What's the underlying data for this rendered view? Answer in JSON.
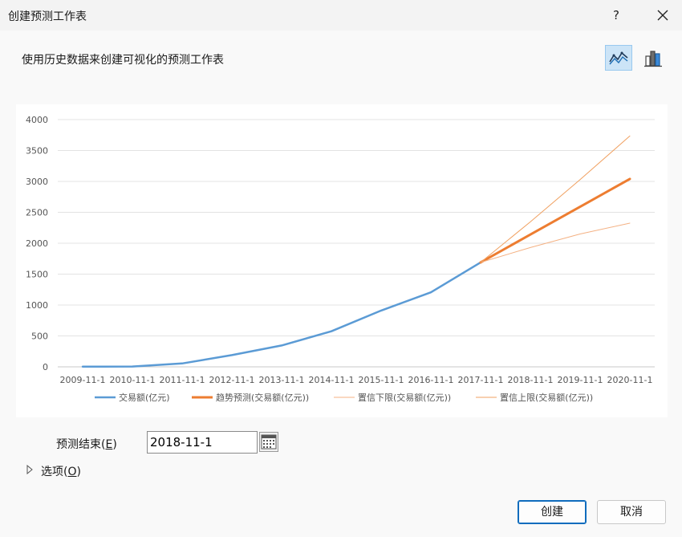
{
  "window": {
    "title": "创建预测工作表",
    "help": "?"
  },
  "subtitle": "使用历史数据来创建可视化的预测工作表",
  "chart_types": {
    "line": "line-chart-icon",
    "column": "column-chart-icon"
  },
  "chart_data": {
    "type": "line",
    "categories": [
      "2009-11-1",
      "2010-11-1",
      "2011-11-1",
      "2012-11-1",
      "2013-11-1",
      "2014-11-1",
      "2015-11-1",
      "2016-11-1",
      "2017-11-1",
      "2018-11-1",
      "2019-11-1",
      "2020-11-1"
    ],
    "yticks": [
      "0",
      "500",
      "1000",
      "1500",
      "2000",
      "2500",
      "3000",
      "3500",
      "4000"
    ],
    "ylim": [
      0,
      4000
    ],
    "grid": true,
    "legend_position": "bottom",
    "series": [
      {
        "name": "交易额(亿元)",
        "color": "#5b9bd5",
        "width": 2.5,
        "values": [
          2,
          5,
          55,
          190,
          345,
          575,
          910,
          1205,
          1690,
          null,
          null,
          null
        ]
      },
      {
        "name": "趋势预测(交易额(亿元))",
        "color": "#ed7d31",
        "width": 3,
        "values": [
          null,
          null,
          null,
          null,
          null,
          null,
          null,
          null,
          1690,
          2140,
          2590,
          3040
        ]
      },
      {
        "name": "置信下限(交易额(亿元))",
        "color": "#f4b183",
        "width": 1,
        "values": [
          null,
          null,
          null,
          null,
          null,
          null,
          null,
          null,
          1690,
          1930,
          2150,
          2325
        ]
      },
      {
        "name": "置信上限(交易额(亿元))",
        "color": "#f0a060",
        "width": 1,
        "values": [
          null,
          null,
          null,
          null,
          null,
          null,
          null,
          null,
          1690,
          2345,
          3030,
          3735
        ]
      }
    ]
  },
  "forecast_end": {
    "label_text": "预测结束(",
    "label_key": "E",
    "label_close": ")",
    "value": "2018-11-1"
  },
  "options": {
    "label_text": "选项(",
    "label_key": "O",
    "label_close": ")"
  },
  "buttons": {
    "create": "创建",
    "cancel": "取消"
  }
}
